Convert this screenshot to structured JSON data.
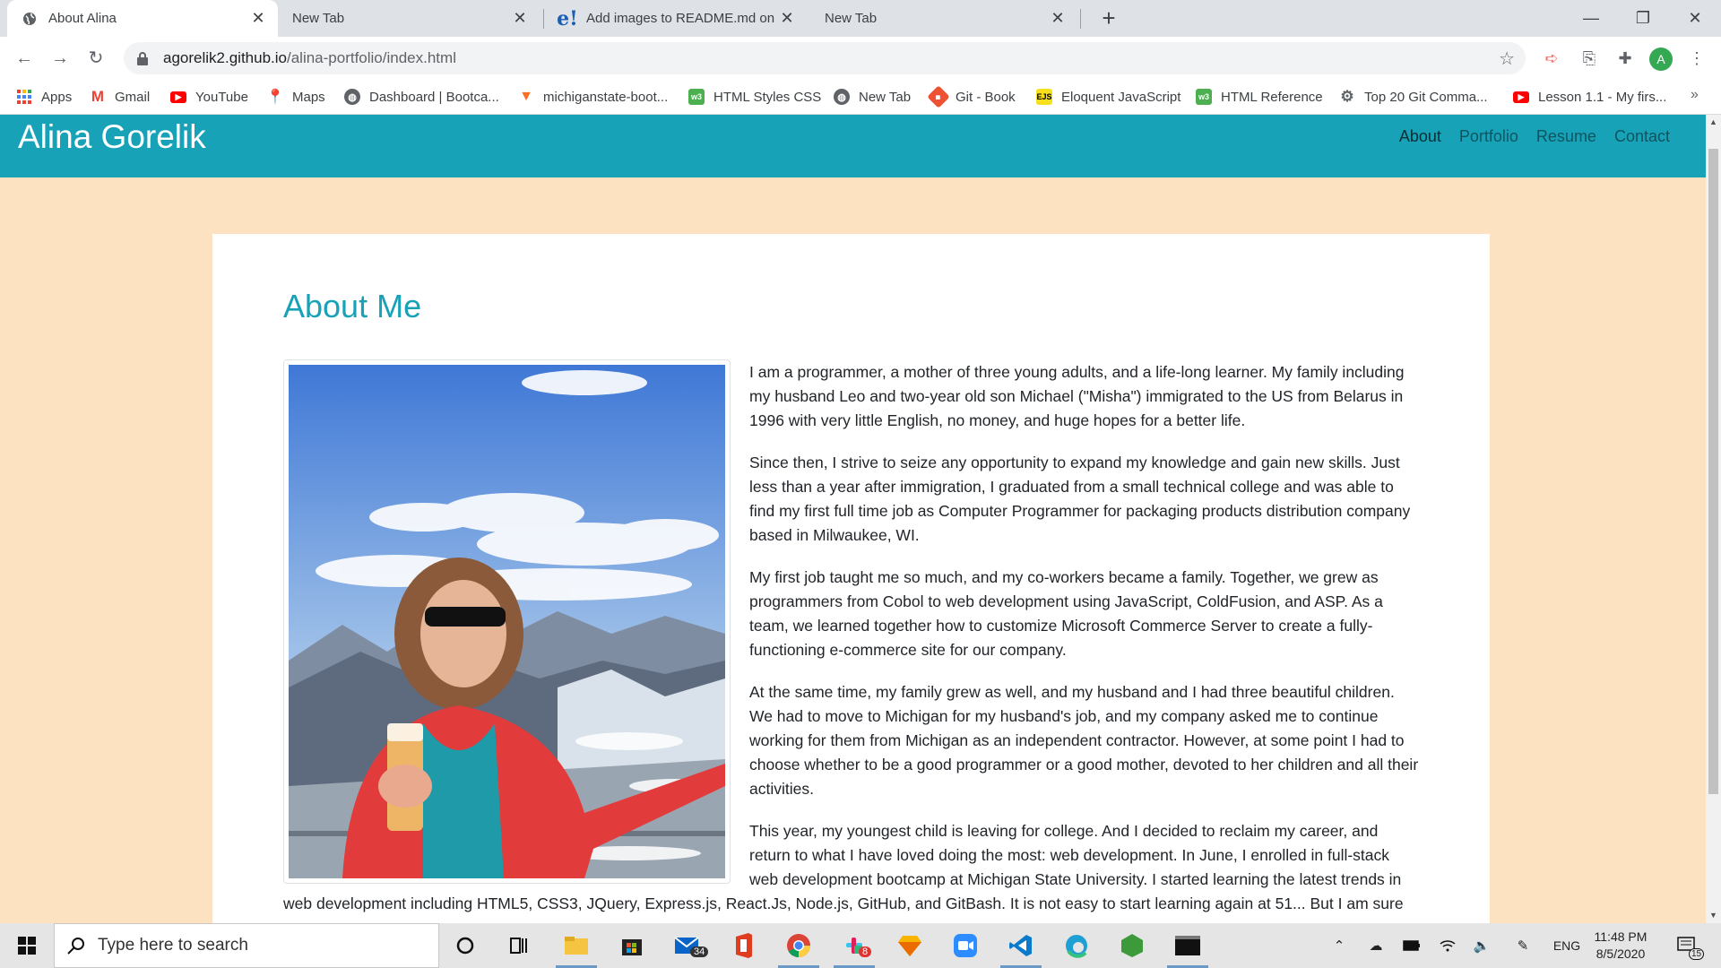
{
  "browser": {
    "tabs": [
      {
        "title": "About Alina",
        "active": true
      },
      {
        "title": "New Tab",
        "active": false
      },
      {
        "title": "Add images to README.md on G",
        "active": false
      },
      {
        "title": "New Tab",
        "active": false
      }
    ],
    "url_host": "agorelik2.github.io",
    "url_path": "/alina-portfolio/index.html",
    "profile_initial": "A",
    "bookmarks": [
      "Apps",
      "Gmail",
      "YouTube",
      "Maps",
      "Dashboard | Bootca...",
      "michiganstate-boot...",
      "HTML Styles CSS",
      "New Tab",
      "Git - Book",
      "Eloquent JavaScript",
      "HTML Reference",
      "Top 20 Git Comma...",
      "Lesson 1.1 - My firs..."
    ]
  },
  "site": {
    "name": "Alina Gorelik",
    "nav": [
      "About",
      "Portfolio",
      "Resume",
      "Contact"
    ],
    "heading": "About Me",
    "paragraphs": [
      "I am a programmer, a mother of three young adults, and a life-long learner. My family including my husband Leo and two-year old son Michael (\"Misha\") immigrated to the US from Belarus in 1996 with very little English, no money, and huge hopes for a better life.",
      "Since then, I strive to seize any opportunity to expand my knowledge and gain new skills. Just less than a year after immigration, I graduated from a small technical college and was able to find my first full time job as Computer Programmer for packaging products distribution company based in Milwaukee, WI.",
      "My first job taught me so much, and my co-workers became a family. Together, we grew as programmers from Cobol to web development using JavaScript, ColdFusion, and ASP. As a team, we learned together how to customize Microsoft Commerce Server to create a fully-functioning e-commerce site for our company.",
      "At the same time, my family grew as well, and my husband and I had three beautiful children. We had to move to Michigan for my husband's job, and my company asked me to continue working for them from Michigan as an independent contractor. However, at some point I had to choose whether to be a good programmer or a good mother, devoted to her children and all their activities.",
      "This year, my youngest child is leaving for college. And I decided to reclaim my career, and return to what I have loved doing the most: web development. In June, I enrolled in full-stack web development bootcamp at Michigan State University. I started learning the latest trends in web development including HTML5, CSS3, JQuery, Express.js, React.Js, Node.js, GitHub, and GitBash. It is not easy to start learning again at 51... But I am sure"
    ]
  },
  "taskbar": {
    "search_placeholder": "Type here to search",
    "mail_badge": "34",
    "slack_badge": "8",
    "language": "ENG",
    "time": "11:48 PM",
    "date": "8/5/2020",
    "notification_count": "15"
  },
  "colors": {
    "header": "#17a2b8",
    "background": "#fde2c2",
    "card": "#ffffff"
  }
}
